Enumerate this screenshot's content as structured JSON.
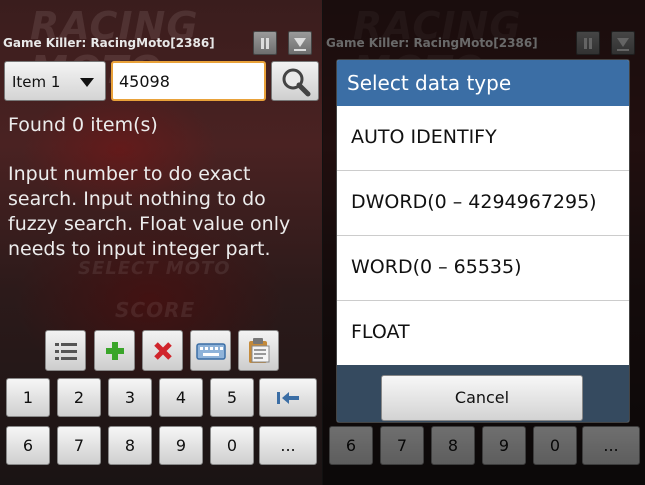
{
  "app": {
    "title": "Game Killer: RacingMoto[2386]"
  },
  "background": {
    "logo": "RACING MOTO",
    "select": "SELECT MOTO",
    "score": "SCORE"
  },
  "search": {
    "type_selected": "Item 1",
    "value": "45098",
    "found": "Found 0 item(s)",
    "help": "Input number to do exact search. Input nothing to do fuzzy search. Float value only needs to input integer part."
  },
  "toolbar": {
    "icons": [
      "list-icon",
      "add-icon",
      "delete-icon",
      "keyboard-icon",
      "clipboard-icon"
    ]
  },
  "keypad": {
    "row1": [
      "1",
      "2",
      "3",
      "4",
      "5"
    ],
    "row2": [
      "6",
      "7",
      "8",
      "9",
      "0"
    ],
    "more": "..."
  },
  "dialog": {
    "title": "Select data type",
    "options": [
      "AUTO IDENTIFY",
      "DWORD(0 – 4294967295)",
      "WORD(0 – 65535)",
      "FLOAT"
    ],
    "cancel": "Cancel"
  },
  "colors": {
    "dialog_header": "#3b6ea5",
    "input_focus": "#e9a23a",
    "dialog_footer": "#354a5f"
  }
}
